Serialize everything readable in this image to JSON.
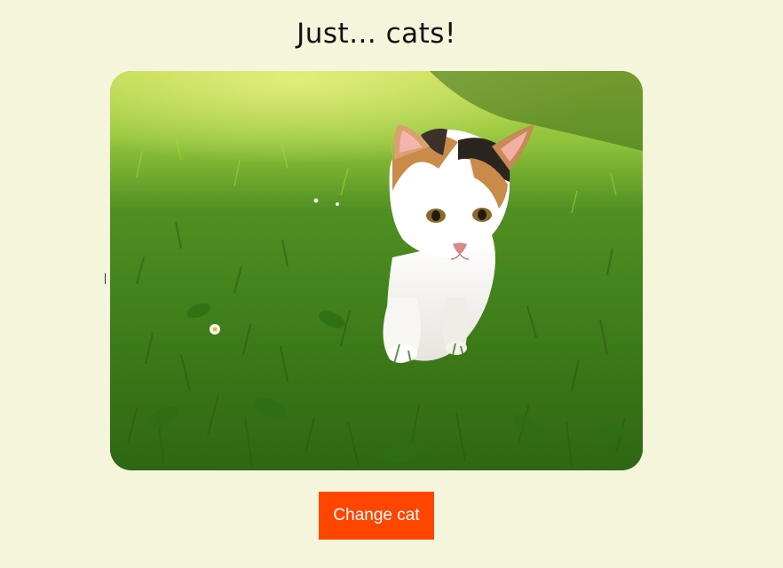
{
  "page": {
    "title": "Just... cats!",
    "image_alt": "cat"
  },
  "actions": {
    "change_cat_label": "Change cat"
  },
  "colors": {
    "background": "#f5f5dc",
    "button": "#ff4500",
    "button_text": "#ffffff"
  }
}
